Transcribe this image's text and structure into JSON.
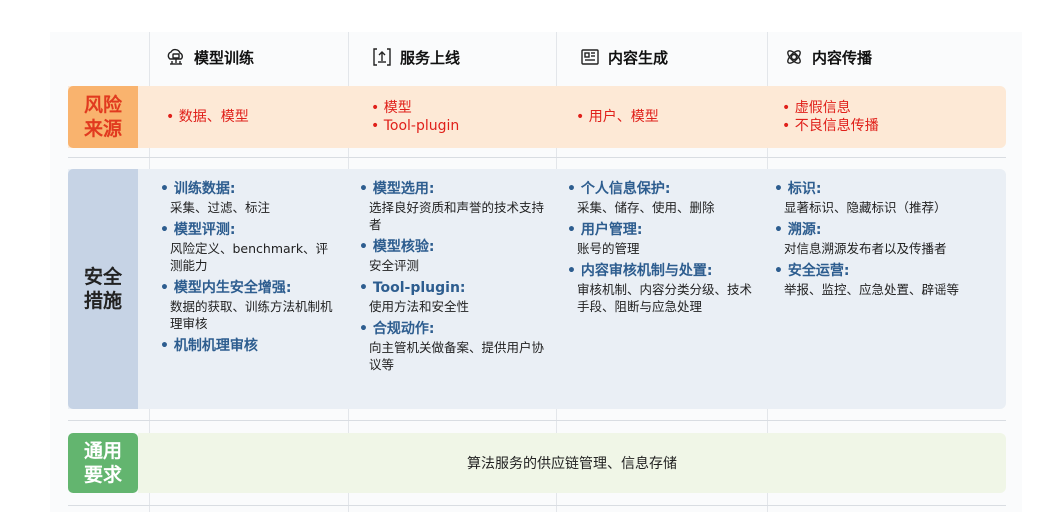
{
  "columns": [
    {
      "title": "模型训练",
      "icon": "ai-chip-icon"
    },
    {
      "title": "服务上线",
      "icon": "upload-icon"
    },
    {
      "title": "内容生成",
      "icon": "document-icon"
    },
    {
      "title": "内容传播",
      "icon": "spread-icon"
    }
  ],
  "rows": {
    "risk": {
      "label": "风险\n来源",
      "cells": [
        [
          "• 数据、模型"
        ],
        [
          "• 模型",
          "• Tool-plugin"
        ],
        [
          "• 用户、模型"
        ],
        [
          "• 虚假信息",
          "• 不良信息传播"
        ]
      ]
    },
    "security": {
      "label": "安全\n措施",
      "cells": [
        [
          {
            "title": "• 训练数据:",
            "desc": "采集、过滤、标注"
          },
          {
            "title": "• 模型评测:",
            "desc": "风险定义、benchmark、评测能力"
          },
          {
            "title": "• 模型内生安全增强:",
            "desc": "数据的获取、训练方法机制机理审核"
          },
          {
            "title": "• 机制机理审核",
            "desc": ""
          }
        ],
        [
          {
            "title": "• 模型选用:",
            "desc": "选择良好资质和声誉的技术支持者"
          },
          {
            "title": "• 模型核验:",
            "desc": "安全评测"
          },
          {
            "title": "• Tool-plugin:",
            "desc": "使用方法和安全性"
          },
          {
            "title": "• 合规动作:",
            "desc": "向主管机关做备案、提供用户协议等"
          }
        ],
        [
          {
            "title": "• 个人信息保护:",
            "desc": "采集、储存、使用、删除"
          },
          {
            "title": "• 用户管理:",
            "desc": "账号的管理"
          },
          {
            "title": "• 内容审核机制与处置:",
            "desc": "审核机制、内容分类分级、技术手段、阻断与应急处理"
          }
        ],
        [
          {
            "title": "• 标识:",
            "desc": "显著标识、隐藏标识（推荐）"
          },
          {
            "title": "• 溯源:",
            "desc": "对信息溯源发布者以及传播者"
          },
          {
            "title": "• 安全运营:",
            "desc": "举报、监控、应急处置、辟谣等"
          }
        ]
      ]
    },
    "general": {
      "label": "通用\n要求",
      "text": "算法服务的供应链管理、信息存储"
    }
  },
  "colors": {
    "risk_label_bg": "#f9b36e",
    "risk_label_text": "#e13a1f",
    "risk_row_bg": "#fde9d6",
    "risk_text": "#e0201a",
    "security_label_bg": "#c6d3e5",
    "security_row_bg": "#eaeff5",
    "security_title": "#2d5d8f",
    "general_label_bg": "#63b56f",
    "general_row_bg": "#f0f6e7"
  }
}
